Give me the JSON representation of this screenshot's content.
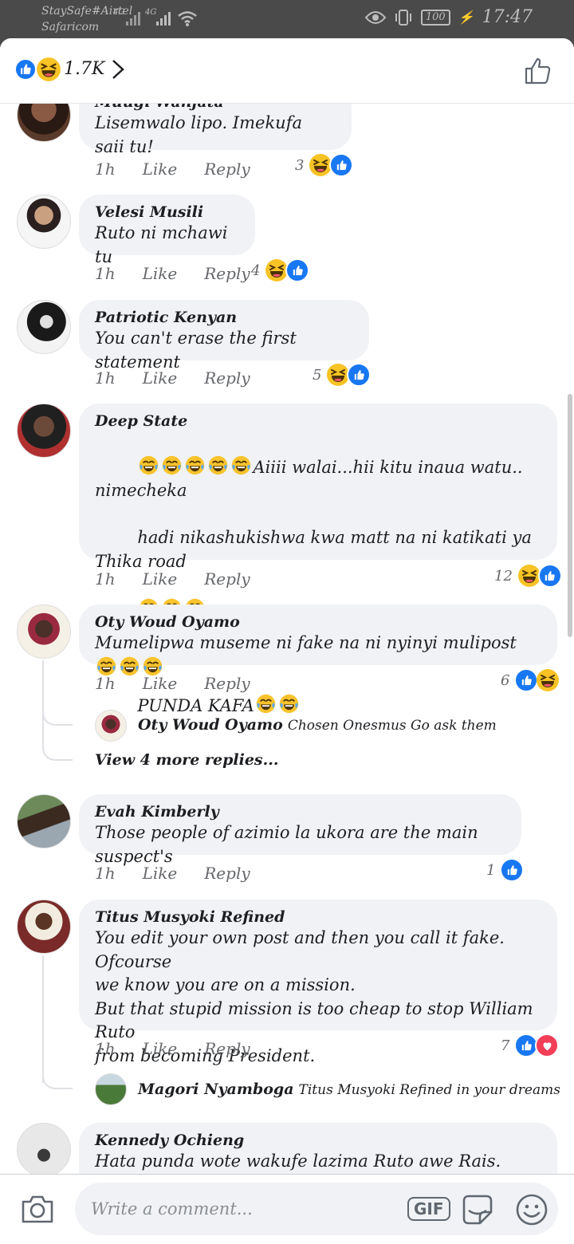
{
  "status_bar": {
    "carrier1": "StaySafe#Airtel",
    "carrier2": "Safaricom",
    "signal1": "4G",
    "signal2": "4G",
    "battery": "100",
    "time": "17:47"
  },
  "header": {
    "reaction_count": "1.7K",
    "icons": [
      "like-icon",
      "haha-icon",
      "chevron-right-icon",
      "like-outline-icon"
    ]
  },
  "comments": [
    {
      "name": "Mũũgĩ Wanjata",
      "text": "Lisemwalo lipo. Imekufa saii tu!",
      "time": "1h",
      "like": "Like",
      "reply": "Reply",
      "reactions_count": "3",
      "reactions": [
        "haha",
        "like"
      ]
    },
    {
      "name": "Velesi Musili",
      "text": "Ruto ni mchawi tu",
      "time": "1h",
      "like": "Like",
      "reply": "Reply",
      "reactions_count": "4",
      "reactions": [
        "haha",
        "like"
      ]
    },
    {
      "name": "Patriotic Kenyan",
      "text": "You can't erase the first statement",
      "time": "1h",
      "like": "Like",
      "reply": "Reply",
      "reactions_count": "5",
      "reactions": [
        "haha",
        "like"
      ]
    },
    {
      "name": "Deep State",
      "text_line1": "Aiiii walai...hii kitu inaua watu.. nimecheka",
      "text_line2": "hadi nikashukishwa kwa matt na ni katikati ya Thika road",
      "text_line4": "PUNDA KAFA",
      "time": "1h",
      "like": "Like",
      "reply": "Reply",
      "reactions_count": "12",
      "reactions": [
        "haha",
        "like"
      ]
    },
    {
      "name": "Oty Woud Oyamo",
      "text": "Mumelipwa museme ni fake na ni nyinyi mulipost",
      "time": "1h",
      "like": "Like",
      "reply": "Reply",
      "reactions_count": "6",
      "reactions": [
        "like",
        "haha"
      ],
      "reply_preview": {
        "name": "Oty Woud Oyamo",
        "text": "Chosen Onesmus Go ask them"
      },
      "view_more": "View 4 more replies..."
    },
    {
      "name": "Evah Kimberly",
      "text": "Those people of azimio la ukora are the main suspect's",
      "time": "1h",
      "like": "Like",
      "reply": "Reply",
      "reactions_count": "1",
      "reactions": [
        "like"
      ]
    },
    {
      "name": "Titus Musyoki Refined",
      "text_line1": "You edit your own post and then you call it fake. Ofcourse",
      "text_line2": "we know you are on a mission.",
      "text_line3": "But that stupid mission is too cheap to stop William Ruto",
      "text_line4": "from becoming President.",
      "time": "1h",
      "like": "Like",
      "reply": "Reply",
      "reactions_count": "7",
      "reactions": [
        "like",
        "love"
      ],
      "reply_preview": {
        "name": "Magori Nyamboga",
        "text": "Titus Musyoki Refined in your dreams"
      }
    },
    {
      "name": "Kennedy Ochieng",
      "text": "Hata punda wote wakufe lazima Ruto awe Rais. Washenzi"
    }
  ],
  "composer": {
    "placeholder": "Write a comment...",
    "gif_label": "GIF",
    "icons": [
      "camera-icon",
      "sticker-icon",
      "emoji-icon"
    ]
  },
  "colors": {
    "like": "#1877f2",
    "haha": "#f7c325",
    "love": "#f33e58",
    "bubble": "#f0f2f5",
    "meta": "#65676b"
  }
}
